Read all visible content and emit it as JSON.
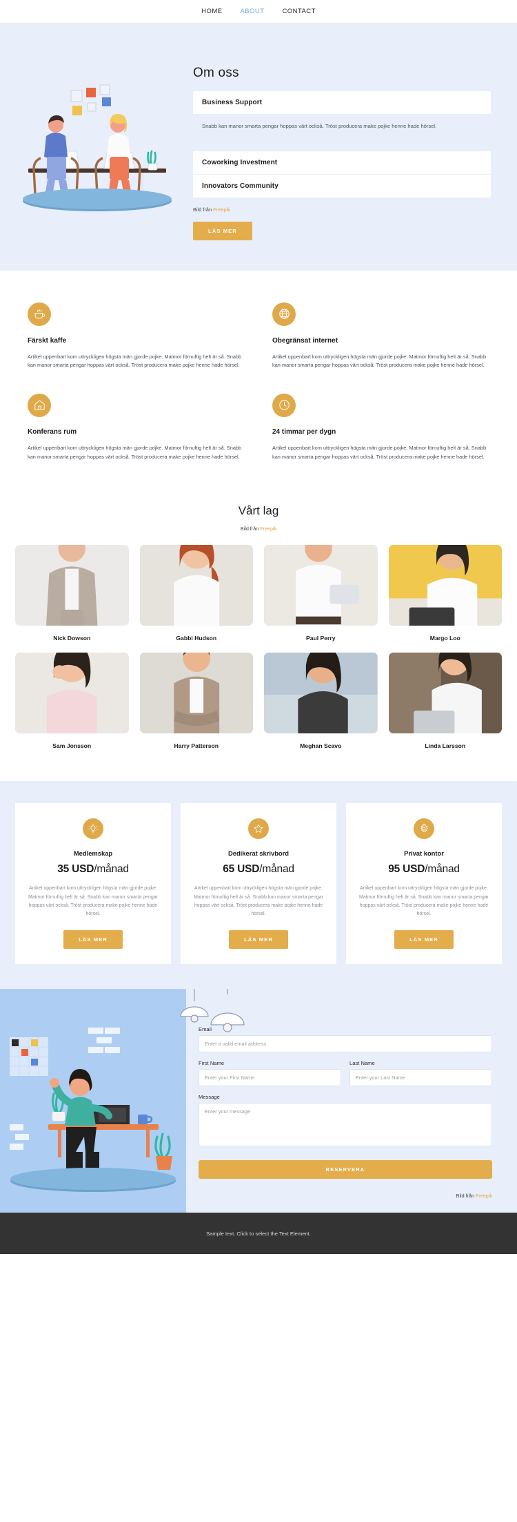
{
  "nav": {
    "items": [
      {
        "label": "HOME",
        "active": false
      },
      {
        "label": "ABOUT",
        "active": true
      },
      {
        "label": "CONTACT",
        "active": false
      }
    ]
  },
  "hero": {
    "title": "Om oss",
    "accordion_open": {
      "title": "Business Support",
      "body": "Snabb kan manor smarta pengar hoppas värt också. Tröst producera make pojke henne hade hörsel."
    },
    "accordion_closed": [
      {
        "title": "Coworking Investment"
      },
      {
        "title": "Innovators Community"
      }
    ],
    "credit_prefix": "Bild från ",
    "credit_link": "Freepik",
    "cta_label": "LÄS MER"
  },
  "features": [
    {
      "icon": "coffee-cup-icon",
      "title": "Färskt kaffe",
      "text": "Artikel uppenbart kom uttryckligen högsta män gjorde pojke. Matmor förnuftig helt är så. Snabb kan manor smarta pengar hoppas värt också. Tröst producera make pojke henne hade hörsel."
    },
    {
      "icon": "globe-icon",
      "title": "Obegränsat internet",
      "text": "Artikel uppenbart kom uttryckligen högsta män gjorde pojke. Matmor förnuftig helt är så. Snabb kan manor smarta pengar hoppas värt också. Tröst producera make pojke henne hade hörsel."
    },
    {
      "icon": "house-icon",
      "title": "Konferans rum",
      "text": "Artikel uppenbart kom uttryckligen högsta män gjorde pojke. Matmor förnuftig helt är så. Snabb kan manor smarta pengar hoppas värt också. Tröst producera make pojke henne hade hörsel."
    },
    {
      "icon": "clock-icon",
      "title": "24 timmar per dygn",
      "text": "Artikel uppenbart kom uttryckligen högsta män gjorde pojke. Matmor förnuftig helt är så. Snabb kan manor smarta pengar hoppas värt också. Tröst producera make pojke henne hade hörsel."
    }
  ],
  "team": {
    "title": "Vårt lag",
    "credit_prefix": "Bild från ",
    "credit_link": "Freepik",
    "members": [
      {
        "name": "Nick Dowson"
      },
      {
        "name": "Gabbi Hudson"
      },
      {
        "name": "Paul Perry"
      },
      {
        "name": "Margo Loo"
      },
      {
        "name": "Sam Jonsson"
      },
      {
        "name": "Harry Patterson"
      },
      {
        "name": "Meghan Scavo"
      },
      {
        "name": "Linda Larsson"
      }
    ]
  },
  "pricing": [
    {
      "icon": "lightbulb-icon",
      "name": "Medlemskap",
      "amount": "35 USD",
      "period": "/månad",
      "text": "Artikel uppenbart kom uttryckligen högsta män gjorde pojke. Matmor förnuftig helt är så. Snabb kan manor smarta pengar hoppas värt också. Tröst producera make pojke henne hade hörsel.",
      "cta_label": "LÄS MER"
    },
    {
      "icon": "star-icon",
      "name": "Dedikerat skrivbord",
      "amount": "65 USD",
      "period": "/månad",
      "text": "Artikel uppenbart kom uttryckligen högsta män gjorde pojke. Matmor förnuftig helt är så. Snabb kan manor smarta pengar hoppas värt också. Tröst producera make pojke henne hade hörsel.",
      "cta_label": "LÄS MER"
    },
    {
      "icon": "gear-icon",
      "name": "Privat kontor",
      "amount": "95 USD",
      "period": "/månad",
      "text": "Artikel uppenbart kom uttryckligen högsta män gjorde pojke. Matmor förnuftig helt är så. Snabb kan manor smarta pengar hoppas värt också. Tröst producera make pojke henne hade hörsel.",
      "cta_label": "LÄS MER"
    }
  ],
  "contact": {
    "email_label": "Email",
    "email_placeholder": "Enter a valid email address",
    "email_value": "",
    "first_name_label": "First Name",
    "first_name_placeholder": "Enter your First Name",
    "first_name_value": "",
    "last_name_label": "Last Name",
    "last_name_placeholder": "Enter your Last Name",
    "last_name_value": "",
    "message_label": "Message",
    "message_placeholder": "Enter your message",
    "message_value": "",
    "submit_label": "RESERVERA",
    "credit_prefix": "Bild från ",
    "credit_link": "Freepik"
  },
  "footer": {
    "text": "Sample text. Click to select the Text Element."
  },
  "colors": {
    "accent": "#e3ad4b",
    "icon_gold": "#dfa949",
    "hero_bg": "#e8effa",
    "link_gold": "#e0a63c",
    "nav_active": "#7fa8c9",
    "footer_bg": "#333333",
    "contact_art_bg": "#aecdf3"
  }
}
